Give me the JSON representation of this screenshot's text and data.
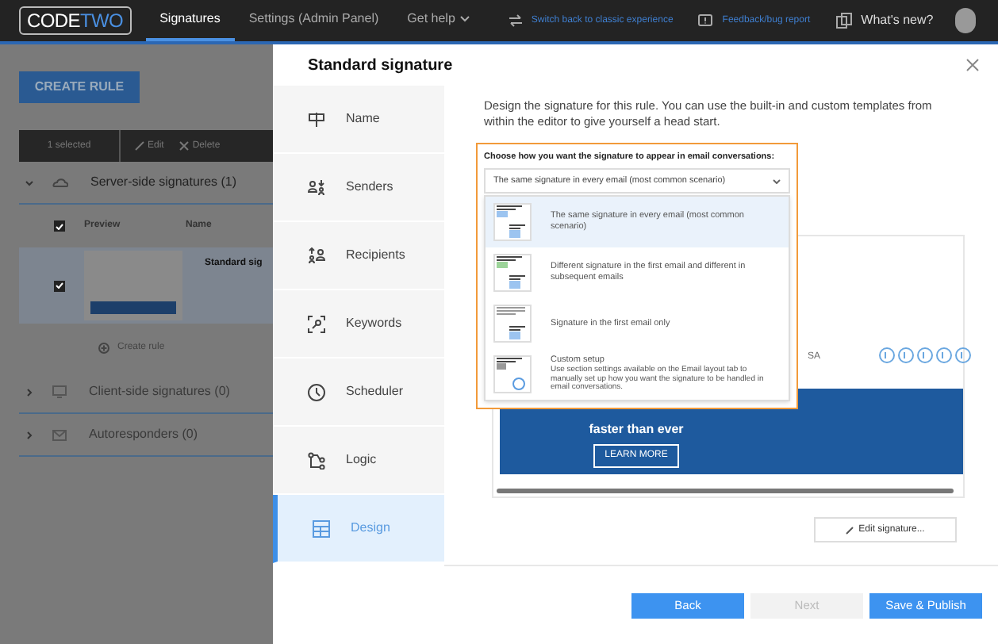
{
  "topbar": {
    "logo": [
      "CODE",
      "TWO"
    ],
    "nav": [
      {
        "label": "Signatures",
        "selected": true
      },
      {
        "label": "Settings (Admin Panel)",
        "selected": false
      },
      {
        "label": "Get help",
        "selected": false
      }
    ],
    "links": [
      {
        "label": "Switch back to classic experience",
        "kind": "switch"
      },
      {
        "label": "Feedback/bug report",
        "kind": "feedback"
      },
      {
        "label": "What's new?",
        "kind": "news"
      }
    ]
  },
  "background": {
    "create_button": "CREATE RULE",
    "toolbar": [
      "1 selected",
      "Edit",
      "Delete"
    ],
    "groups": [
      {
        "title": "Server-side signatures (1)",
        "expanded": true,
        "kind": "server"
      },
      {
        "title": "Client-side signatures (0)",
        "expanded": false,
        "kind": "client"
      },
      {
        "title": "Autoresponders (0)",
        "expanded": false,
        "kind": "auto"
      }
    ],
    "table": {
      "columns": [
        "Preview",
        "Name"
      ],
      "header_checked": true,
      "rows": [
        {
          "name": "Standard sig",
          "checked": true
        }
      ]
    },
    "create_rule": "Create rule"
  },
  "modal": {
    "title": "Standard signature",
    "steps": [
      {
        "label": "Name",
        "selected": false,
        "kind": "name"
      },
      {
        "label": "Senders",
        "selected": false,
        "kind": "senders"
      },
      {
        "label": "Recipients",
        "selected": false,
        "kind": "recipients"
      },
      {
        "label": "Keywords",
        "selected": false,
        "kind": "keywords"
      },
      {
        "label": "Scheduler",
        "selected": false,
        "kind": "scheduler"
      },
      {
        "label": "Logic",
        "selected": false,
        "kind": "logic"
      },
      {
        "label": "Design",
        "selected": true,
        "kind": "design"
      }
    ],
    "description": "Design the signature for this rule. You can use the built-in and custom templates from within the editor to give yourself a head start.",
    "mode_label": "Choose how you want the signature to appear in email conversations:",
    "mode_value": "The same signature in every email (most common scenario)",
    "options": [
      {
        "title": "The same signature in every email (most common scenario)",
        "selected": true,
        "kind": "same"
      },
      {
        "title": "Different signature in the first email and different in subsequent emails",
        "selected": false,
        "kind": "different"
      },
      {
        "title": "Signature in the first email only",
        "selected": false,
        "kind": "first"
      },
      {
        "title": "Custom setup",
        "detail": "Use section settings available on the Email layout tab to manually set up how you want the signature to be handled in email conversations.",
        "selected": false,
        "kind": "custom"
      }
    ],
    "preview": {
      "address_tail": "SA",
      "banner_text": "faster than ever",
      "banner_button": "LEARN MORE"
    },
    "edit_button": "Edit signature...",
    "buttons": [
      {
        "label": "Back",
        "disabled": false
      },
      {
        "label": "Next",
        "disabled": true
      },
      {
        "label": "Save & Publish",
        "disabled": false
      }
    ]
  }
}
